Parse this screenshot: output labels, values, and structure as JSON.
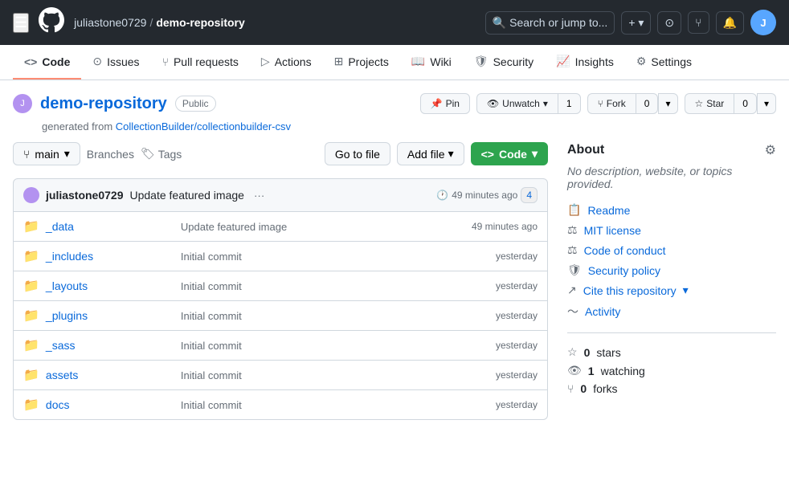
{
  "topNav": {
    "owner": "juliastone0729",
    "separator": "/",
    "repo": "demo-repository",
    "searchPlaceholder": "Search or jump to...",
    "searchIcon": "🔍",
    "plusLabel": "+",
    "issuesIcon": "⊙",
    "prIcon": "⑂",
    "notifIcon": "🔔",
    "avatarInitials": "J"
  },
  "tabs": [
    {
      "id": "code",
      "icon": "<>",
      "label": "Code",
      "active": true
    },
    {
      "id": "issues",
      "icon": "⊙",
      "label": "Issues",
      "active": false
    },
    {
      "id": "pullrequests",
      "icon": "⑂",
      "label": "Pull requests",
      "active": false
    },
    {
      "id": "actions",
      "icon": "▷",
      "label": "Actions",
      "active": false
    },
    {
      "id": "projects",
      "icon": "⊞",
      "label": "Projects",
      "active": false
    },
    {
      "id": "wiki",
      "icon": "📖",
      "label": "Wiki",
      "active": false
    },
    {
      "id": "security",
      "icon": "🛡",
      "label": "Security",
      "active": false
    },
    {
      "id": "insights",
      "icon": "📈",
      "label": "Insights",
      "active": false
    },
    {
      "id": "settings",
      "icon": "⚙",
      "label": "Settings",
      "active": false
    }
  ],
  "repoHeader": {
    "repoName": "demo-repository",
    "visibility": "Public",
    "generatedFrom": "CollectionBuilder/collectionbuilder-csv",
    "generatedLabel": "generated from",
    "pinLabel": "Pin",
    "watchLabel": "Unwatch",
    "watchCount": "1",
    "forkLabel": "Fork",
    "forkCount": "0",
    "starLabel": "Star",
    "starCount": "0"
  },
  "fileSection": {
    "branch": "main",
    "branchesLabel": "Branches",
    "tagsLabel": "Tags",
    "goToFileLabel": "Go to file",
    "addFileLabel": "Add file",
    "codeLabel": "Code",
    "commitAuthor": "juliastone0729",
    "commitMessage": "Update featured image",
    "commitTime": "49 minutes ago",
    "commitHashLabel": "4",
    "files": [
      {
        "type": "folder",
        "name": "_data",
        "message": "Update featured image",
        "time": "49 minutes ago"
      },
      {
        "type": "folder",
        "name": "_includes",
        "message": "Initial commit",
        "time": "yesterday"
      },
      {
        "type": "folder",
        "name": "_layouts",
        "message": "Initial commit",
        "time": "yesterday"
      },
      {
        "type": "folder",
        "name": "_plugins",
        "message": "Initial commit",
        "time": "yesterday"
      },
      {
        "type": "folder",
        "name": "_sass",
        "message": "Initial commit",
        "time": "yesterday"
      },
      {
        "type": "folder",
        "name": "assets",
        "message": "Initial commit",
        "time": "yesterday"
      },
      {
        "type": "folder",
        "name": "docs",
        "message": "Initial commit",
        "time": "yesterday"
      }
    ]
  },
  "about": {
    "title": "About",
    "description": "No description, website, or topics provided.",
    "links": [
      {
        "id": "readme",
        "icon": "📋",
        "label": "Readme"
      },
      {
        "id": "mit-license",
        "icon": "⚖",
        "label": "MIT license"
      },
      {
        "id": "code-of-conduct",
        "icon": "⚖",
        "label": "Code of conduct"
      },
      {
        "id": "security-policy",
        "icon": "🛡",
        "label": "Security policy"
      },
      {
        "id": "cite-repo",
        "icon": "↗",
        "label": "Cite this repository"
      },
      {
        "id": "activity",
        "icon": "~",
        "label": "Activity"
      }
    ],
    "stats": [
      {
        "id": "stars",
        "icon": "☆",
        "count": "0",
        "label": "stars"
      },
      {
        "id": "watching",
        "icon": "👁",
        "count": "1",
        "label": "watching"
      },
      {
        "id": "forks",
        "icon": "⑂",
        "count": "0",
        "label": "forks"
      }
    ]
  }
}
